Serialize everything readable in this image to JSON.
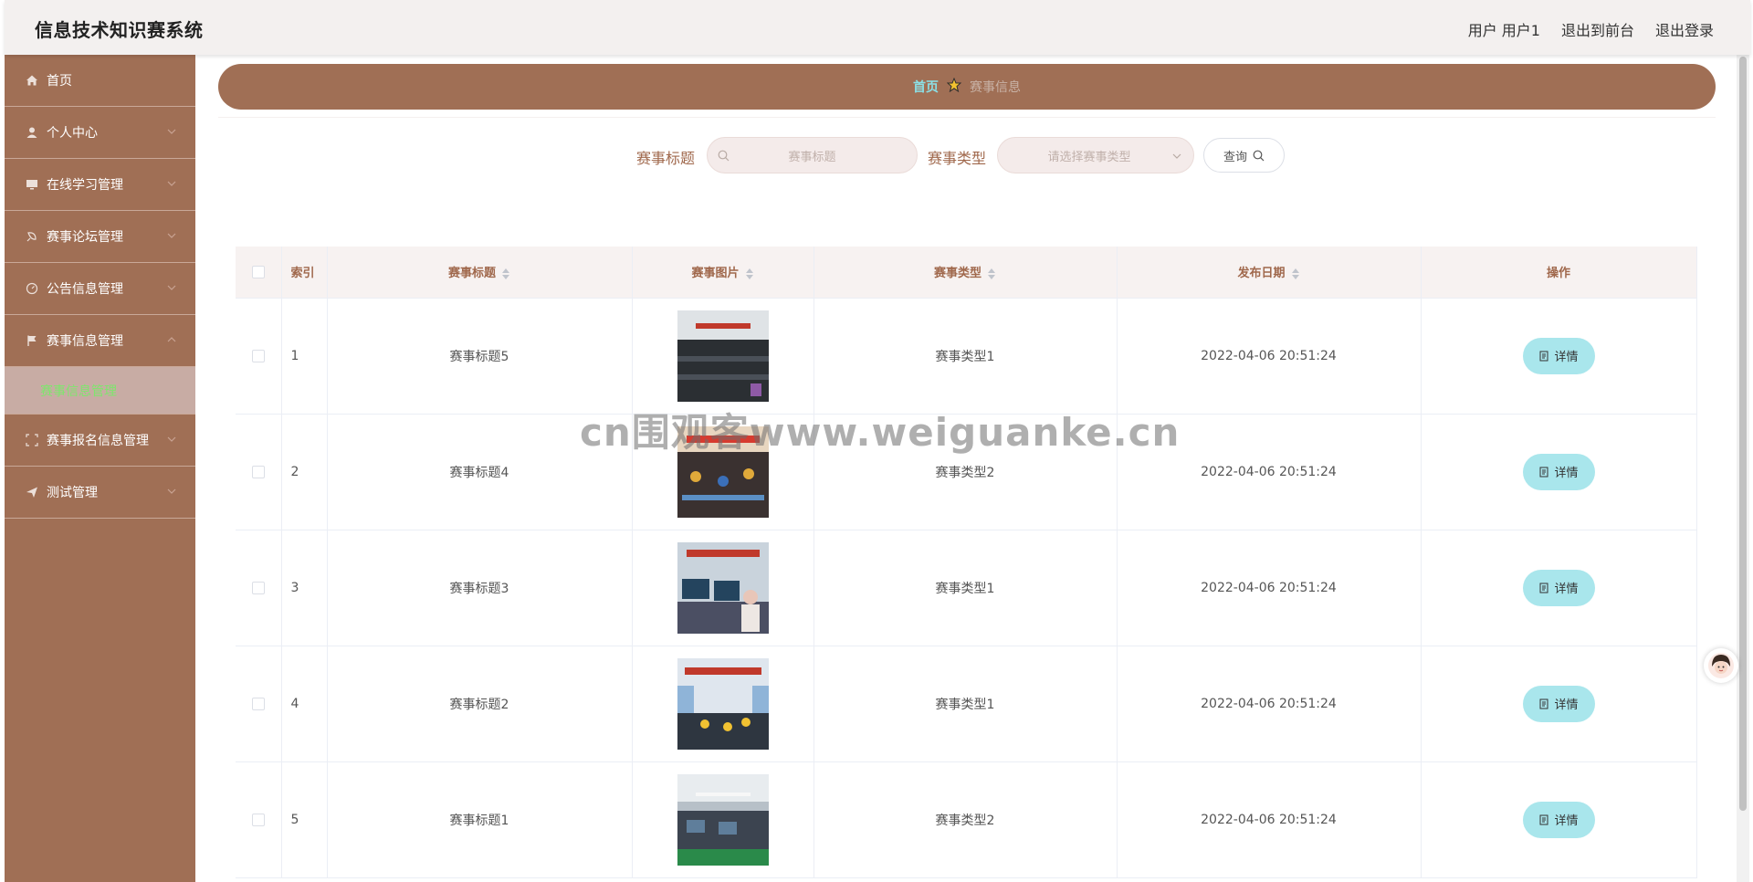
{
  "header": {
    "app_title": "信息技术知识赛系统",
    "user_label": "用户 用户1",
    "back_to_front": "退出到前台",
    "logout": "退出登录"
  },
  "sidebar": {
    "items": [
      {
        "label": "首页",
        "icon": "home-icon"
      },
      {
        "label": "个人中心",
        "icon": "user-icon"
      },
      {
        "label": "在线学习管理",
        "icon": "monitor-icon"
      },
      {
        "label": "赛事论坛管理",
        "icon": "forum-icon"
      },
      {
        "label": "公告信息管理",
        "icon": "notice-icon"
      },
      {
        "label": "赛事信息管理",
        "icon": "flag-icon",
        "expanded": true
      },
      {
        "label": "赛事报名信息管理",
        "icon": "signup-icon"
      },
      {
        "label": "测试管理",
        "icon": "send-icon"
      }
    ],
    "submenu_active": "赛事信息管理"
  },
  "breadcrumb": {
    "home": "首页",
    "current": "赛事信息"
  },
  "search": {
    "title_label": "赛事标题",
    "title_placeholder": "赛事标题",
    "type_label": "赛事类型",
    "type_placeholder": "请选择赛事类型",
    "query_button": "查询"
  },
  "table": {
    "columns": {
      "index": "索引",
      "title": "赛事标题",
      "image": "赛事图片",
      "type": "赛事类型",
      "date": "发布日期",
      "actions": "操作"
    },
    "detail_label": "详情",
    "rows": [
      {
        "index": "1",
        "title": "赛事标题5",
        "type": "赛事类型1",
        "date": "2022-04-06 20:51:24"
      },
      {
        "index": "2",
        "title": "赛事标题4",
        "type": "赛事类型2",
        "date": "2022-04-06 20:51:24"
      },
      {
        "index": "3",
        "title": "赛事标题3",
        "type": "赛事类型1",
        "date": "2022-04-06 20:51:24"
      },
      {
        "index": "4",
        "title": "赛事标题2",
        "type": "赛事类型1",
        "date": "2022-04-06 20:51:24"
      },
      {
        "index": "5",
        "title": "赛事标题1",
        "type": "赛事类型2",
        "date": "2022-04-06 20:51:24"
      }
    ]
  },
  "watermark": "cn围观客www.weiguanke.cn",
  "colors": {
    "sidebar_bg": "#a06f55",
    "header_bg": "#f3f0ef",
    "accent_teal": "#a9e6ec",
    "label_brown": "#a0684c",
    "submenu_active_text": "#7ee66d"
  }
}
